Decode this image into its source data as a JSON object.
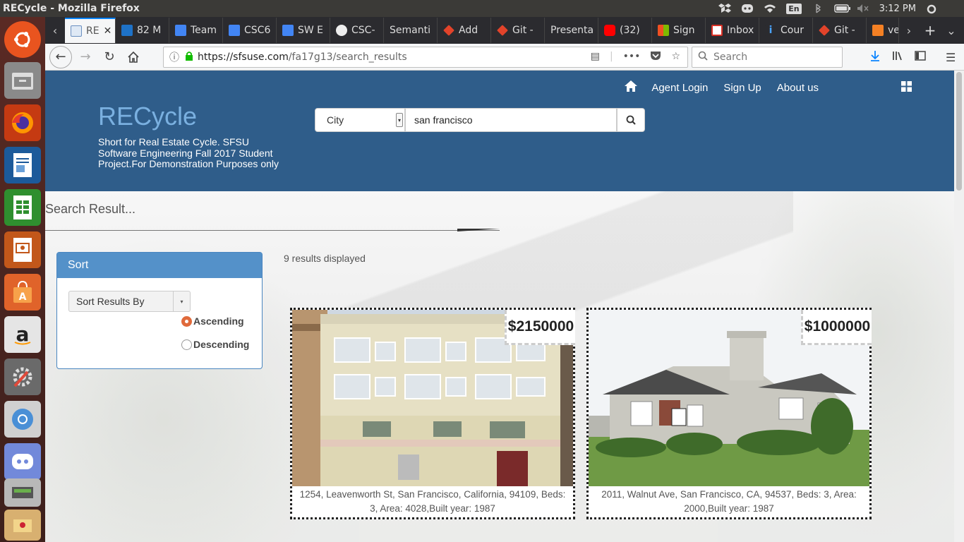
{
  "os": {
    "window_title": "RECycle - Mozilla Firefox",
    "lang": "En",
    "clock": "3:12 PM"
  },
  "browser": {
    "tabs": [
      {
        "label": "RE",
        "active": true
      },
      {
        "label": "82 M"
      },
      {
        "label": "Team"
      },
      {
        "label": "CSC6"
      },
      {
        "label": "SW E"
      },
      {
        "label": "CSC-"
      },
      {
        "label": "Semanti"
      },
      {
        "label": "Add"
      },
      {
        "label": "Git -"
      },
      {
        "label": "Presenta"
      },
      {
        "label": "(32)"
      },
      {
        "label": "Sign"
      },
      {
        "label": "Inbox"
      },
      {
        "label": "Cour"
      },
      {
        "label": "Git -"
      },
      {
        "label": "ve"
      }
    ],
    "url_host": "https://sfsuse.com",
    "url_path": "/fa17g13/search_results",
    "search_placeholder": "Search"
  },
  "site": {
    "brand": "RECycle",
    "tagline": "Short for Real Estate Cycle. SFSU Software Engineering Fall 2017 Student Project.For Demonstration Purposes only",
    "nav": {
      "agent_login": "Agent Login",
      "sign_up": "Sign Up",
      "about": "About us"
    },
    "search": {
      "filter": "City",
      "query": "san francisco"
    },
    "results_title": "Search Result...",
    "results_count": "9 results displayed",
    "sort": {
      "title": "Sort",
      "dropdown": "Sort Results By",
      "ascending": "Ascending",
      "descending": "Descending"
    },
    "listings": [
      {
        "price": "$2150000",
        "address": "1254, Leavenworth St, San Francisco, California, 94109, Beds: 3, Area: 4028,Built year: 1987"
      },
      {
        "price": "$1000000",
        "address": "2011, Walnut Ave, San Francisco, CA, 94537, Beds: 3, Area: 2000,Built year: 1987"
      }
    ]
  }
}
